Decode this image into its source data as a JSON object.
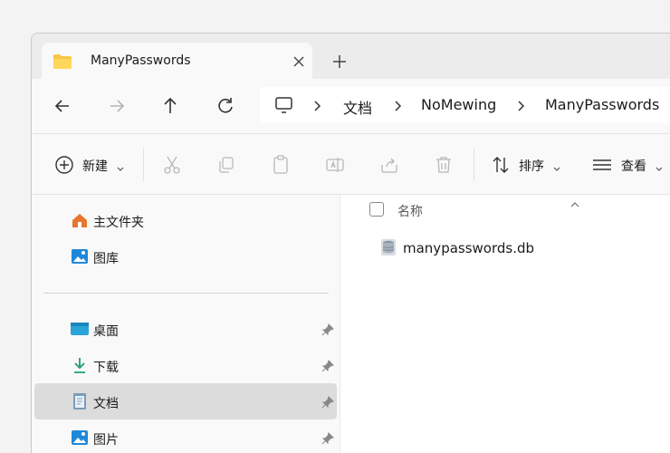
{
  "tab": {
    "title": "ManyPasswords",
    "icon": "folder-icon",
    "close_icon": "close-icon",
    "new_tab_icon": "plus-icon"
  },
  "nav": {
    "back_icon": "arrow-left-icon",
    "forward_icon": "arrow-right-icon",
    "up_icon": "arrow-up-icon",
    "refresh_icon": "refresh-icon"
  },
  "address": {
    "root_icon": "monitor-icon",
    "crumbs": [
      "文档",
      "NoMewing",
      "ManyPasswords"
    ]
  },
  "toolbar": {
    "new_label": "新建",
    "sort_label": "排序",
    "view_label": "查看"
  },
  "sidebar": {
    "items": [
      {
        "label": "主文件夹",
        "icon": "home-icon"
      },
      {
        "label": "图库",
        "icon": "gallery-icon"
      },
      {
        "label": "桌面",
        "icon": "desktop-icon"
      },
      {
        "label": "下载",
        "icon": "download-icon"
      },
      {
        "label": "文档",
        "icon": "document-icon"
      },
      {
        "label": "图片",
        "icon": "pictures-icon"
      }
    ]
  },
  "files": {
    "column_name": "名称",
    "items": [
      {
        "name": "manypasswords.db",
        "icon": "database-file-icon"
      }
    ]
  },
  "colors": {
    "accent": "#0067c0",
    "folder": "#f8c642",
    "selected": "#dcdcdc"
  }
}
